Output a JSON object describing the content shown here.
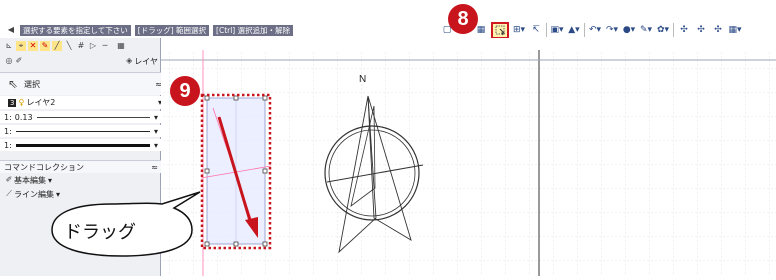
{
  "statusbar": {
    "hint1": "選択する要素を指定して下さい",
    "hint2": "[ドラッグ] 範囲選択",
    "hint3": "[Ctrl] 選択追加・解除"
  },
  "left_panel": {
    "layer_button": "レイヤ",
    "section_title": "選択",
    "layer_value": "レイヤ2",
    "line_width_prefix": "1:",
    "line_width_value": "0.13",
    "row2_prefix": "1:",
    "row3_prefix": "1:",
    "command_title": "コマンドコレクション",
    "command_item1": "基本編集",
    "command_item2": "ライン編集"
  },
  "callouts": {
    "badge_toolbar": "8",
    "badge_canvas": "9",
    "drag_label": "ドラッグ"
  },
  "drawing": {
    "north_label": "N"
  },
  "colors": {
    "badge": "#c8141c",
    "selection_dotted": "#c8141c",
    "selection_fill": "#e8ecff",
    "ruler": "#6f83e0"
  }
}
